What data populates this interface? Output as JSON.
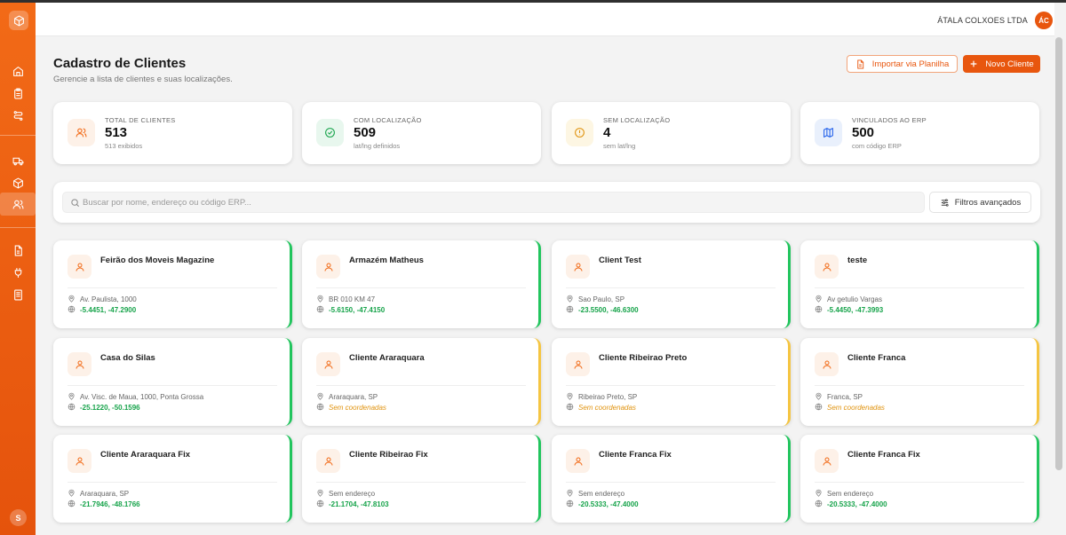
{
  "header": {
    "company": "ÁTALA COLXOES LTDA",
    "company_initials": "ÁC"
  },
  "sidebar": {
    "logo_icon": "package-icon",
    "items": [
      {
        "name": "home",
        "icon": "home-icon"
      },
      {
        "name": "clipboard",
        "icon": "clipboard-icon"
      },
      {
        "name": "routes",
        "icon": "route-icon"
      },
      {
        "name": "delivery",
        "icon": "truck-icon"
      },
      {
        "name": "products",
        "icon": "box-icon"
      },
      {
        "name": "clients",
        "icon": "users-icon",
        "active": true
      },
      {
        "name": "reports",
        "icon": "file-icon"
      },
      {
        "name": "integrations",
        "icon": "plug-icon"
      },
      {
        "name": "documents",
        "icon": "receipt-icon"
      }
    ],
    "user_initial": "S"
  },
  "page": {
    "title": "Cadastro de Clientes",
    "subtitle": "Gerencie a lista de clientes e suas localizações.",
    "import_button": "Importar via Planilha",
    "new_button": "Novo Cliente"
  },
  "stats": [
    {
      "label": "TOTAL DE CLIENTES",
      "value": "513",
      "sub": "513 exibidos",
      "color": "#f26a17",
      "icon": "users-icon"
    },
    {
      "label": "COM LOCALIZAÇÃO",
      "value": "509",
      "sub": "lat/lng definidos",
      "color": "#16a34a",
      "icon": "check-circle-icon"
    },
    {
      "label": "SEM LOCALIZAÇÃO",
      "value": "4",
      "sub": "sem lat/lng",
      "color": "#e0930f",
      "icon": "alert-circle-icon"
    },
    {
      "label": "VINCULADOS AO ERP",
      "value": "500",
      "sub": "com código ERP",
      "color": "#2563eb",
      "icon": "map-icon"
    }
  ],
  "search": {
    "placeholder": "Buscar por nome, endereço ou código ERP...",
    "value": "",
    "filters_label": "Filtros avançados"
  },
  "clients": [
    {
      "name": "Feirão dos Moveis Magazine",
      "address": "Av. Paulista, 1000",
      "coords": "-5.4451, -47.2900",
      "has_coords": true
    },
    {
      "name": "Armazém Matheus",
      "address": "BR 010 KM 47",
      "coords": "-5.6150, -47.4150",
      "has_coords": true
    },
    {
      "name": "Client Test",
      "address": "Sao Paulo, SP",
      "coords": "-23.5500, -46.6300",
      "has_coords": true
    },
    {
      "name": "teste",
      "address": "Av getulio Vargas",
      "coords": "-5.4450, -47.3993",
      "has_coords": true
    },
    {
      "name": "Casa do Silas",
      "address": "Av. Visc. de Maua, 1000, Ponta Grossa",
      "coords": "-25.1220, -50.1596",
      "has_coords": true
    },
    {
      "name": "Cliente Araraquara",
      "address": "Araraquara, SP",
      "coords": "Sem coordenadas",
      "has_coords": false
    },
    {
      "name": "Cliente Ribeirao Preto",
      "address": "Ribeirao Preto, SP",
      "coords": "Sem coordenadas",
      "has_coords": false
    },
    {
      "name": "Cliente Franca",
      "address": "Franca, SP",
      "coords": "Sem coordenadas",
      "has_coords": false
    },
    {
      "name": "Cliente Araraquara Fix",
      "address": "Araraquara, SP",
      "coords": "-21.7946, -48.1766",
      "has_coords": true
    },
    {
      "name": "Cliente Ribeirao Fix",
      "address": "Sem endereço",
      "coords": "-21.1704, -47.8103",
      "has_coords": true
    },
    {
      "name": "Cliente Franca Fix",
      "address": "Sem endereço",
      "coords": "-20.5333, -47.4000",
      "has_coords": true
    },
    {
      "name": "Cliente Franca Fix",
      "address": "Sem endereço",
      "coords": "-20.5333, -47.4000",
      "has_coords": true
    }
  ]
}
